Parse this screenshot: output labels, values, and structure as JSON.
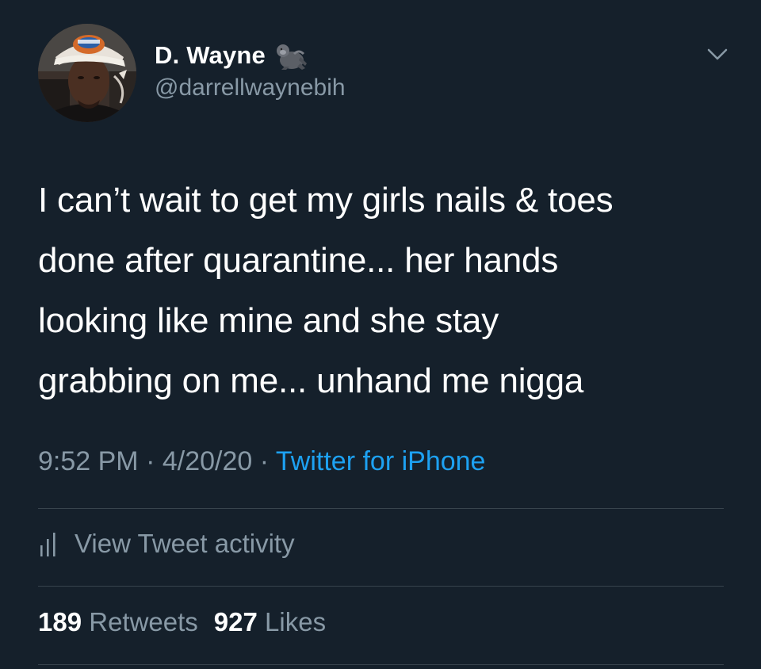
{
  "tweet": {
    "author": {
      "display_name": "D. Wayne",
      "handle": "@darrellwaynebih",
      "name_emoji": "gorilla-icon",
      "avatar": "avatar-photo"
    },
    "text_lines": [
      "I can’t wait to get my girls nails & toes",
      "done after quarantine... her hands",
      "looking like mine and she stay",
      "grabbing on me... unhand me nigga"
    ],
    "time": "9:52 PM",
    "separator": " · ",
    "date": "4/20/20",
    "source": "Twitter for iPhone",
    "activity_label": "View Tweet activity",
    "retweets_count": "189",
    "retweets_label": "Retweets",
    "likes_count": "927",
    "likes_label": "Likes"
  },
  "colors": {
    "background": "#15202b",
    "text_primary": "#ffffff",
    "text_secondary": "#8899a6",
    "accent": "#1da1f2",
    "divider": "#38444d"
  }
}
